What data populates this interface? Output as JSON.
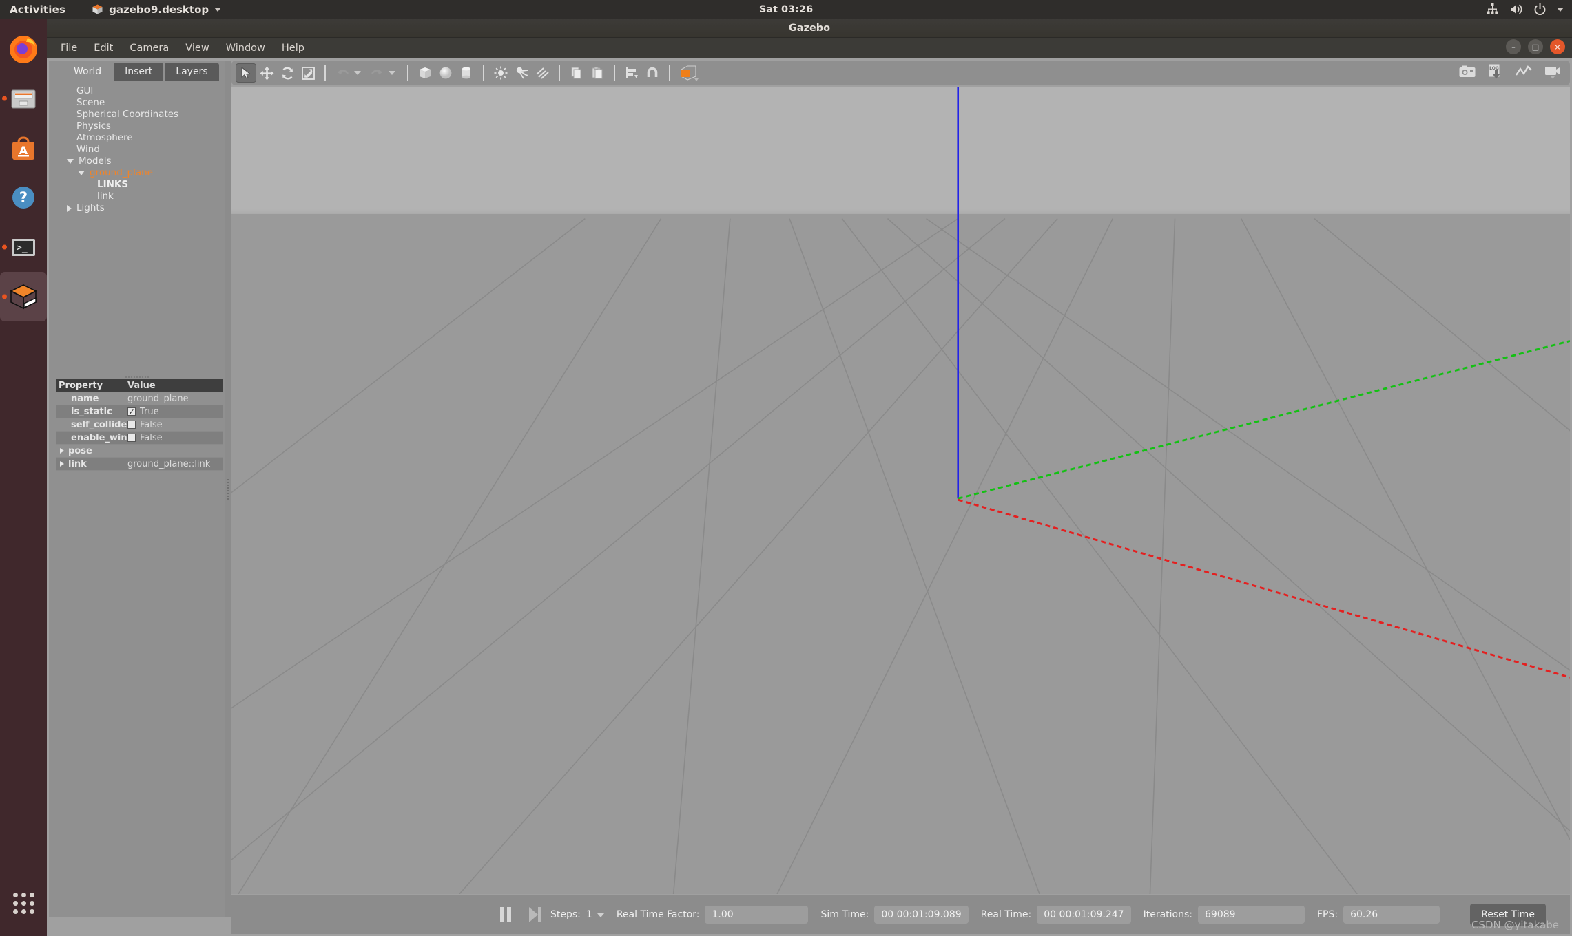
{
  "desktop": {
    "activities_label": "Activities",
    "app_menu_label": "gazebo9.desktop",
    "clock": "Sat 03:26",
    "tray_icons": [
      "network-icon",
      "volume-icon",
      "power-icon",
      "chevron-down-icon"
    ],
    "dock_items": [
      {
        "name": "firefox",
        "running": false
      },
      {
        "name": "files",
        "running": true
      },
      {
        "name": "software-center",
        "running": false
      },
      {
        "name": "help",
        "running": false
      },
      {
        "name": "terminal",
        "running": true
      },
      {
        "name": "gazebo",
        "running": true,
        "active": true
      }
    ]
  },
  "window": {
    "title": "Gazebo",
    "controls": {
      "minimize": "–",
      "maximize": "□",
      "close": "×"
    }
  },
  "menubar": {
    "items": [
      {
        "label": "File",
        "mnemonic": "F",
        "rest": "ile"
      },
      {
        "label": "Edit",
        "mnemonic": "E",
        "rest": "dit"
      },
      {
        "label": "Camera",
        "mnemonic": "C",
        "rest": "amera"
      },
      {
        "label": "View",
        "mnemonic": "V",
        "rest": "iew"
      },
      {
        "label": "Window",
        "mnemonic": "W",
        "rest": "indow"
      },
      {
        "label": "Help",
        "mnemonic": "H",
        "rest": "elp"
      }
    ]
  },
  "left_panel": {
    "tabs": [
      {
        "label": "World",
        "active": true
      },
      {
        "label": "Insert",
        "active": false
      },
      {
        "label": "Layers",
        "active": false
      }
    ],
    "tree": [
      {
        "label": "GUI",
        "indent": 0,
        "expander": "none",
        "style": "normal"
      },
      {
        "label": "Scene",
        "indent": 0,
        "expander": "none",
        "style": "normal"
      },
      {
        "label": "Spherical Coordinates",
        "indent": 0,
        "expander": "none",
        "style": "normal"
      },
      {
        "label": "Physics",
        "indent": 0,
        "expander": "none",
        "style": "normal"
      },
      {
        "label": "Atmosphere",
        "indent": 0,
        "expander": "none",
        "style": "normal"
      },
      {
        "label": "Wind",
        "indent": 0,
        "expander": "none",
        "style": "normal"
      },
      {
        "label": "Models",
        "indent": 1,
        "expander": "down",
        "style": "normal"
      },
      {
        "label": "ground_plane",
        "indent": 2,
        "expander": "down",
        "style": "selected"
      },
      {
        "label": "LINKS",
        "indent": 3,
        "expander": "none",
        "style": "bold"
      },
      {
        "label": "link",
        "indent": 3,
        "expander": "none",
        "style": "normal"
      },
      {
        "label": "Lights",
        "indent": 1,
        "expander": "right",
        "style": "normal"
      }
    ],
    "property_table": {
      "columns": [
        "Property",
        "Value"
      ],
      "rows": [
        {
          "key": "name",
          "value": "ground_plane",
          "type": "text"
        },
        {
          "key": "is_static",
          "value": "True",
          "type": "checkbox",
          "checked": true
        },
        {
          "key": "self_collide",
          "value": "False",
          "type": "checkbox",
          "checked": false
        },
        {
          "key": "enable_wind",
          "value": "False",
          "type": "checkbox",
          "checked": false
        },
        {
          "key": "pose",
          "value": "",
          "type": "expander"
        },
        {
          "key": "link",
          "value": "ground_plane::link",
          "type": "expander"
        }
      ]
    }
  },
  "toolbar": {
    "left_tools": [
      {
        "name": "select-mode",
        "icon": "cursor-arrow-icon",
        "pressed": true
      },
      {
        "name": "translate-mode",
        "icon": "move-arrows-icon",
        "pressed": false
      },
      {
        "name": "rotate-mode",
        "icon": "rotate-icon",
        "pressed": false
      },
      {
        "name": "scale-mode",
        "icon": "scale-icon",
        "pressed": false
      },
      {
        "name": "undo",
        "icon": "undo-arrow-icon",
        "pressed": false
      },
      {
        "name": "undo-history",
        "icon": "chevron-down-icon",
        "pressed": false
      },
      {
        "name": "redo",
        "icon": "redo-arrow-icon",
        "pressed": false
      },
      {
        "name": "redo-history",
        "icon": "chevron-down-icon",
        "pressed": false
      },
      {
        "name": "insert-box",
        "icon": "box-icon",
        "pressed": false
      },
      {
        "name": "insert-sphere",
        "icon": "sphere-icon",
        "pressed": false
      },
      {
        "name": "insert-cylinder",
        "icon": "cylinder-icon",
        "pressed": false
      },
      {
        "name": "insert-point-light",
        "icon": "point-light-icon",
        "pressed": false
      },
      {
        "name": "insert-spot-light",
        "icon": "spot-light-icon",
        "pressed": false
      },
      {
        "name": "insert-directional-light",
        "icon": "directional-light-icon",
        "pressed": false
      },
      {
        "name": "copy",
        "icon": "copy-icon",
        "pressed": false
      },
      {
        "name": "paste",
        "icon": "paste-icon",
        "pressed": false
      },
      {
        "name": "align",
        "icon": "align-icon",
        "pressed": false
      },
      {
        "name": "snap",
        "icon": "magnet-icon",
        "pressed": false
      },
      {
        "name": "view-angle",
        "icon": "view-cube-icon",
        "pressed": false
      }
    ],
    "right_tools": [
      {
        "name": "screenshot",
        "icon": "camera-icon"
      },
      {
        "name": "log-record",
        "icon": "log-download-icon"
      },
      {
        "name": "plot-window",
        "icon": "plot-line-icon"
      },
      {
        "name": "video-record",
        "icon": "video-camera-icon"
      }
    ]
  },
  "viewport": {
    "sky_color": "#b3b3b3",
    "ground_color": "#9a9a9a",
    "grid_color": "#8a8a8a",
    "axis_z_color": "#2020e0",
    "axis_y_color": "#11bb11",
    "axis_x_color": "#e02020"
  },
  "statusbar": {
    "pause_icon": "pause-icon",
    "step_icon": "step-forward-icon",
    "steps_label": "Steps:",
    "steps_value": "1",
    "rtf_label": "Real Time Factor:",
    "rtf_value": "1.00",
    "sim_time_label": "Sim Time:",
    "sim_time_value": "00 00:01:09.089",
    "real_time_label": "Real Time:",
    "real_time_value": "00 00:01:09.247",
    "iterations_label": "Iterations:",
    "iterations_value": "69089",
    "fps_label": "FPS:",
    "fps_value": "60.26",
    "reset_button": "Reset Time"
  },
  "watermark": "CSDN @yitakabe"
}
